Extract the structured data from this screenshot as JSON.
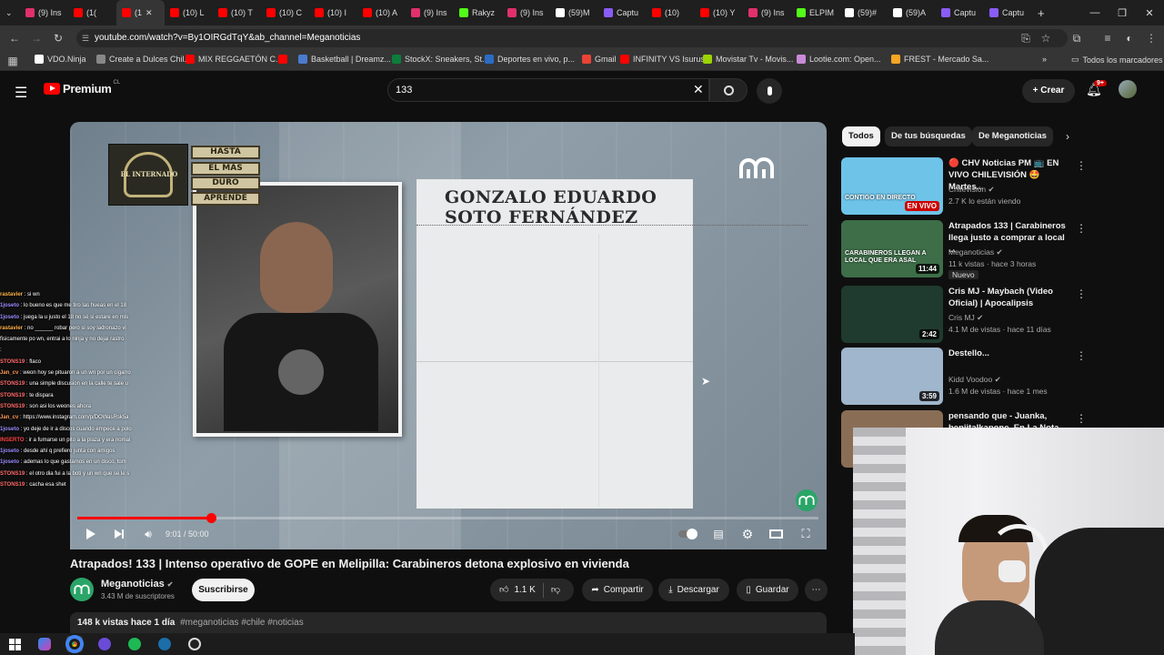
{
  "browser": {
    "tabs": [
      {
        "label": "(9) Ins",
        "color": "#e1306c"
      },
      {
        "label": "(1(",
        "color": "#ff0000"
      },
      {
        "label": "(1",
        "color": "#ff0000"
      },
      {
        "label": "(10) L",
        "color": "#ff0000"
      },
      {
        "label": "(10) T",
        "color": "#ff0000"
      },
      {
        "label": "(10) C",
        "color": "#ff0000"
      },
      {
        "label": "(10) I",
        "color": "#ff0000"
      },
      {
        "label": "(10) A",
        "color": "#ff0000"
      },
      {
        "label": "(9) Ins",
        "color": "#e1306c"
      },
      {
        "label": "Rakyz",
        "color": "#53fc18"
      },
      {
        "label": "(9) Ins",
        "color": "#e1306c"
      },
      {
        "label": "(59)M",
        "color": "#ffffff"
      },
      {
        "label": "Captu",
        "color": "#8a5cf6"
      },
      {
        "label": "(10)",
        "color": "#ff0000"
      },
      {
        "label": "(10) Y",
        "color": "#ff0000"
      },
      {
        "label": "(9) Ins",
        "color": "#e1306c"
      },
      {
        "label": "ELPIM",
        "color": "#53fc18"
      },
      {
        "label": "(59)#",
        "color": "#ffffff"
      },
      {
        "label": "(59)A",
        "color": "#ffffff"
      },
      {
        "label": "Captu",
        "color": "#8a5cf6"
      },
      {
        "label": "Captu",
        "color": "#8a5cf6"
      }
    ],
    "new_tab": "+",
    "url": "youtube.com/watch?v=By1OIRGdTqY&ab_channel=Meganoticias",
    "bookmarks": [
      {
        "label": "VDO.Ninja",
        "color": "#ffffff"
      },
      {
        "label": "Create a Dulces Chil...",
        "color": "#888888"
      },
      {
        "label": "MIX REGGAETÓN C...",
        "color": "#ff0000"
      },
      {
        "label": "",
        "color": "#ff0000"
      },
      {
        "label": "Basketball | Dreamz...",
        "color": "#4a7bd0"
      },
      {
        "label": "StockX: Sneakers, St...",
        "color": "#0d7d3a"
      },
      {
        "label": "Deportes en vivo, p...",
        "color": "#2b6cc4"
      },
      {
        "label": "Gmail",
        "color": "#ea4335"
      },
      {
        "label": "INFINITY VS Isurus",
        "color": "#ff0000"
      },
      {
        "label": "Movistar Tv - Movis...",
        "color": "#9bd400"
      },
      {
        "label": "Lootie.com: Open...",
        "color": "#c98bd8"
      },
      {
        "label": "FREST - Mercado Sa...",
        "color": "#f5a623"
      }
    ],
    "all_bookmarks": "Todos los marcadores"
  },
  "youtube": {
    "logo": "Premium",
    "logo_region": "CL",
    "search_value": "133",
    "create_label": "+ Crear",
    "notif_count": "9+"
  },
  "video": {
    "overlay_name": "GONZALO EDUARDO SOTO FERNÁNDEZ",
    "overlay_name_line1": "GONZALO EDUARDO",
    "overlay_name_line2": "SOTO FERNÁNDEZ",
    "badge_tags": [
      "HASTA",
      "EL MÁS",
      "DURO",
      "APRENDE"
    ],
    "badge_logo": "EL INTERNADO",
    "time_current": "9:01",
    "time_total": "50:00",
    "time_label": "9:01 / 50:00",
    "progress": 0.18,
    "title": "Atrapados! 133 | Intenso operativo de GOPE en Melipilla: Carabineros detona explosivo en vivienda",
    "channel": "Meganoticias",
    "subscribers": "3.43 M de suscriptores",
    "subscribe_label": "Suscribirse",
    "likes": "1.1 K",
    "share_label": "Compartir",
    "download_label": "Descargar",
    "save_label": "Guardar",
    "description": "148 k vistas  hace 1 día",
    "hashtags": "#meganoticias #chile #noticias"
  },
  "chat": [
    {
      "user": "rastavier",
      "color": "#ffb347",
      "msg": ": si wn"
    },
    {
      "user": "1joseto",
      "color": "#9b8cff",
      "msg": ": lo bueno es que me tiro las hueas en el 18"
    },
    {
      "user": "1joseto",
      "color": "#9b8cff",
      "msg": ": juega la u justo el 18 no sé si estare en mis"
    },
    {
      "user": "rastavier",
      "color": "#ffb347",
      "msg": ": no ______ robar pero si soy ladronazo vi"
    },
    {
      "user": "",
      "color": "#ffffff",
      "msg": "fisicamente po wn, entrai a lo ninja y no dejai rastro"
    },
    {
      "user": "",
      "color": "#ff66aa",
      "msg": ":"
    },
    {
      "user": "STONS19",
      "color": "#ff6b6b",
      "msg": ": flaco"
    },
    {
      "user": "Jan_cv",
      "color": "#ff9955",
      "msg": ": weon hoy se pituaron a un wn por un cigarro"
    },
    {
      "user": "STONS19",
      "color": "#ff6b6b",
      "msg": ": una simple discusion en la calle te sale u"
    },
    {
      "user": "STONS19",
      "color": "#ff6b6b",
      "msg": ": te dispara"
    },
    {
      "user": "STONS19",
      "color": "#ff6b6b",
      "msg": ": son asi los weones ahora"
    },
    {
      "user": "Jan_cv",
      "color": "#ff9955",
      "msg": ": https://www.instagram.com/p/DOWasRsk5a"
    },
    {
      "user": "1joseto",
      "color": "#9b8cff",
      "msg": ": yo deje de ir a discos cuando empece a polo"
    },
    {
      "user": "INSERTO",
      "color": "#ff4444",
      "msg": ": ir a fumarse un pito a la plaza y era nomal"
    },
    {
      "user": "1joseto",
      "color": "#9b8cff",
      "msg": ": desde ahí q prefiero junta con amigos"
    },
    {
      "user": "1joseto",
      "color": "#9b8cff",
      "msg": ": ademas lo que gastamos en un disco, tom"
    },
    {
      "user": "STONS19",
      "color": "#ff6b6b",
      "msg": ": el otro dia fui a la boti y un wn que se le s"
    },
    {
      "user": "STONS19",
      "color": "#ff6b6b",
      "msg": ": cacha esa shet"
    }
  ],
  "sidebar": {
    "chips": [
      "Todos",
      "De tus búsquedas",
      "De Meganoticias"
    ],
    "recs": [
      {
        "title": "🔴 CHV Noticias PM 📺 EN VIVO CHILEVISIÓN 🤩 Martes...",
        "channel": "Chilevisión",
        "meta": "2.7 K lo están viendo",
        "duration": "EN VIVO",
        "thumb_color": "#6ec3e8",
        "thumb_text": "CONTIGO EN DIRECTO"
      },
      {
        "title": "Atrapados 133 | Carabineros llega justo a comprar a local ...",
        "channel": "Meganoticias",
        "meta": "11 k vistas · hace 3 horas",
        "duration": "11:44",
        "badge": "Nuevo",
        "thumb_color": "#3d6e48",
        "thumb_text": "CARABINEROS LLEGAN A LOCAL QUE ERA ASAL"
      },
      {
        "title": "Cris MJ - Maybach (Video Oficial) | Apocalipsis",
        "channel": "Cris MJ",
        "meta": "4.1 M de vistas · hace 11 días",
        "duration": "2:42",
        "thumb_color": "#1f3a2e"
      },
      {
        "title": "Destello...",
        "channel": "Kidd Voodoo",
        "meta": "1.6 M de vistas · hace 1 mes",
        "duration": "3:59",
        "thumb_color": "#9fb6cc"
      },
      {
        "title": "pensando que - Juanka, benjitalkapone, En La Nota",
        "channel": "",
        "meta": "",
        "duration": "",
        "thumb_color": "#8a6d55"
      }
    ]
  },
  "taskbar": {
    "icons": [
      "windows-icon",
      "copilot-icon",
      "chrome-icon",
      "app-icon",
      "spotify-icon",
      "steam-icon",
      "obs-icon"
    ]
  }
}
